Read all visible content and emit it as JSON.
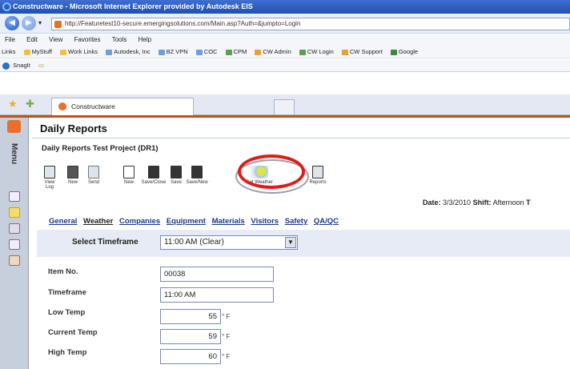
{
  "window": {
    "title": "Constructware - Microsoft Internet Explorer provided by Autodesk EIS"
  },
  "browser": {
    "url": "http://Featuretest10-secure.emergingsolutions.com/Main.asp?Auth=&jumpto=Login",
    "menu": [
      "File",
      "Edit",
      "View",
      "Favorites",
      "Tools",
      "Help"
    ],
    "links_label": "Links",
    "links": [
      "MyStuff",
      "Work Links",
      "Autodesk, Inc",
      "BZ VPN",
      "COC",
      "CPM",
      "CW Admin",
      "CW Login",
      "CW Support",
      "Google"
    ],
    "snagit_label": "SnagIt",
    "tab_label": "Constructware"
  },
  "sidebar": {
    "menu_label": "Menu"
  },
  "page": {
    "title": "Daily Reports",
    "project": "Daily Reports Test Project (DR1)",
    "toolbar": {
      "view_log": "View Log",
      "new1": "New",
      "send": "Send",
      "new2": "New",
      "save_close": "Save/Close",
      "save": "Save",
      "save_new": "Save/New",
      "get_weather": "Get Weather",
      "reports": "Reports"
    },
    "date_label": "Date:",
    "date_value": "3/3/2010",
    "shift_label": "Shift:",
    "shift_value": "Afternoon",
    "shift_trail": "T",
    "tabs": [
      "General",
      "Weather",
      "Companies",
      "Equipment",
      "Materials",
      "Visitors",
      "Safety",
      "QA/QC"
    ],
    "timeframe_label": "Select Timeframe",
    "timeframe_value": "11:00 AM (Clear)",
    "fields": {
      "item_label": "Item No.",
      "item_value": "00038",
      "timeframe_label": "Timeframe",
      "timeframe_value": "11:00 AM",
      "low_label": "Low Temp",
      "low_value": "55",
      "current_label": "Current Temp",
      "current_value": "59",
      "high_label": "High Temp",
      "high_value": "60",
      "unit": "° F"
    }
  }
}
